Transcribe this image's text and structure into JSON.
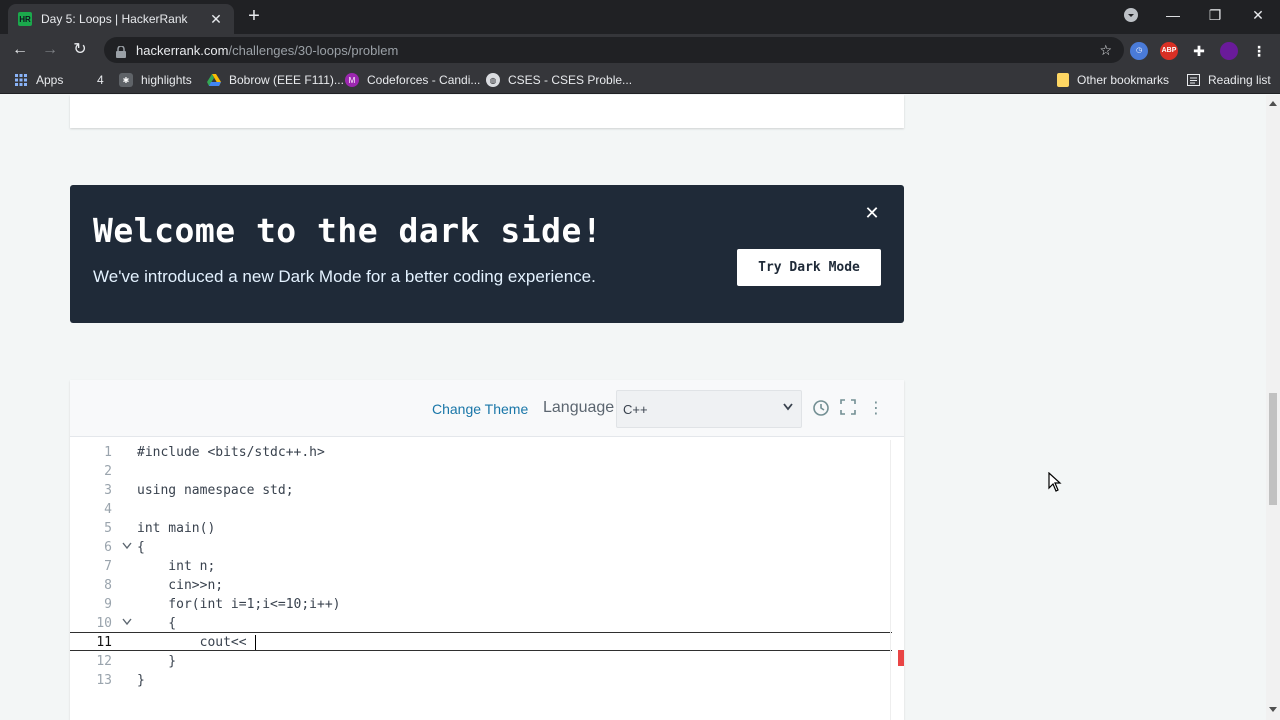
{
  "browser": {
    "tab_title": "Day 5: Loops | HackerRank",
    "tab_favicon_text": "HR",
    "url_host": "hackerrank.com",
    "url_path": "/challenges/30-loops/problem",
    "extensions": [
      "clock-extension-icon",
      "adblock-plus-icon",
      "extensions-puzzle-icon",
      "profile-avatar"
    ],
    "abp_text": "ABP"
  },
  "bookmarks": {
    "items": [
      {
        "label": "Apps"
      },
      {
        "label": "4"
      },
      {
        "label": "highlights"
      },
      {
        "label": "Bobrow (EEE F111)..."
      },
      {
        "label": "Codeforces - Candi..."
      },
      {
        "label": "CSES - CSES Proble..."
      }
    ],
    "codeforces_icon_text": "M",
    "other": "Other bookmarks",
    "reading": "Reading list"
  },
  "banner": {
    "heading": "Welcome to the dark side!",
    "subtitle": "We've introduced a new Dark Mode for a better coding experience.",
    "button": "Try Dark Mode"
  },
  "editor": {
    "change_theme": "Change Theme",
    "language_label": "Language",
    "language_value": "C++",
    "lines": [
      {
        "n": "1",
        "code": "#include <bits/stdc++.h>"
      },
      {
        "n": "2",
        "code": ""
      },
      {
        "n": "3",
        "code": "using namespace std;"
      },
      {
        "n": "4",
        "code": ""
      },
      {
        "n": "5",
        "code": "int main()"
      },
      {
        "n": "6",
        "code": "{"
      },
      {
        "n": "7",
        "code": "    int n;"
      },
      {
        "n": "8",
        "code": "    cin>>n;"
      },
      {
        "n": "9",
        "code": "    for(int i=1;i<=10;i++)"
      },
      {
        "n": "10",
        "code": "    {"
      },
      {
        "n": "11",
        "code": "        cout<<"
      },
      {
        "n": "12",
        "code": "    }"
      },
      {
        "n": "13",
        "code": "}"
      }
    ]
  },
  "colors": {
    "banner_bg": "#1f2a38",
    "hr_green": "#1ba94c",
    "link_blue": "#1976a8",
    "error_red": "#e94545"
  }
}
